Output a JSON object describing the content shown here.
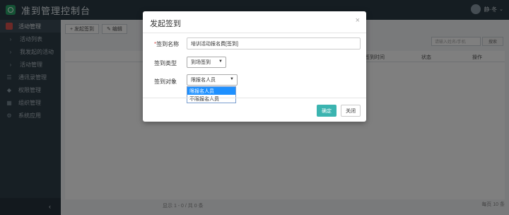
{
  "app": {
    "title": "准到管理控制台"
  },
  "user": {
    "name": "静·冬",
    "caret": "⌄"
  },
  "sidebar": {
    "items": [
      {
        "label": "活动管理",
        "icon": "red-square-icon"
      },
      {
        "label": "活动列表",
        "icon": "bullet-icon"
      },
      {
        "label": "我发起的活动",
        "icon": "bullet-icon"
      },
      {
        "label": "活动管理",
        "icon": "bullet-icon"
      },
      {
        "label": "通讯录管理",
        "icon": "list-icon"
      },
      {
        "label": "权限管理",
        "icon": "shield-icon"
      },
      {
        "label": "组织管理",
        "icon": "building-icon"
      },
      {
        "label": "系统应用",
        "icon": "gear-icon"
      }
    ],
    "collapse_label": "‹"
  },
  "main": {
    "toolbar": {
      "add_label": "+ 发起签到",
      "edit_label": "✎ 编辑"
    },
    "search": {
      "placeholder": "请输入姓名/手机",
      "button_label": "搜索"
    },
    "table": {
      "headers": [
        "签到时间",
        "状态",
        "操作"
      ]
    },
    "footer_left": "显示 1 - 0 / 共 0 条",
    "footer_right": "每页 10 条"
  },
  "modal": {
    "title": "发起签到",
    "close": "×",
    "fields": {
      "name_label": "签到名称",
      "name_required": "*",
      "name_value": "培训活动报名费[签到]",
      "type_label": "签到类型",
      "type_value": "到场签到",
      "target_label": "签到对象",
      "target_value": "限报名人员"
    },
    "dropdown_options": [
      {
        "label": "限报名人员",
        "selected": true
      },
      {
        "label": "不限报名人员",
        "selected": false
      }
    ],
    "ok_label": "确定",
    "cancel_label": "关闭"
  },
  "colors": {
    "topbar": "#2b3a45",
    "sidebar": "#2f3e49",
    "accent": "#3bb4b0",
    "selected": "#1e90ff"
  }
}
